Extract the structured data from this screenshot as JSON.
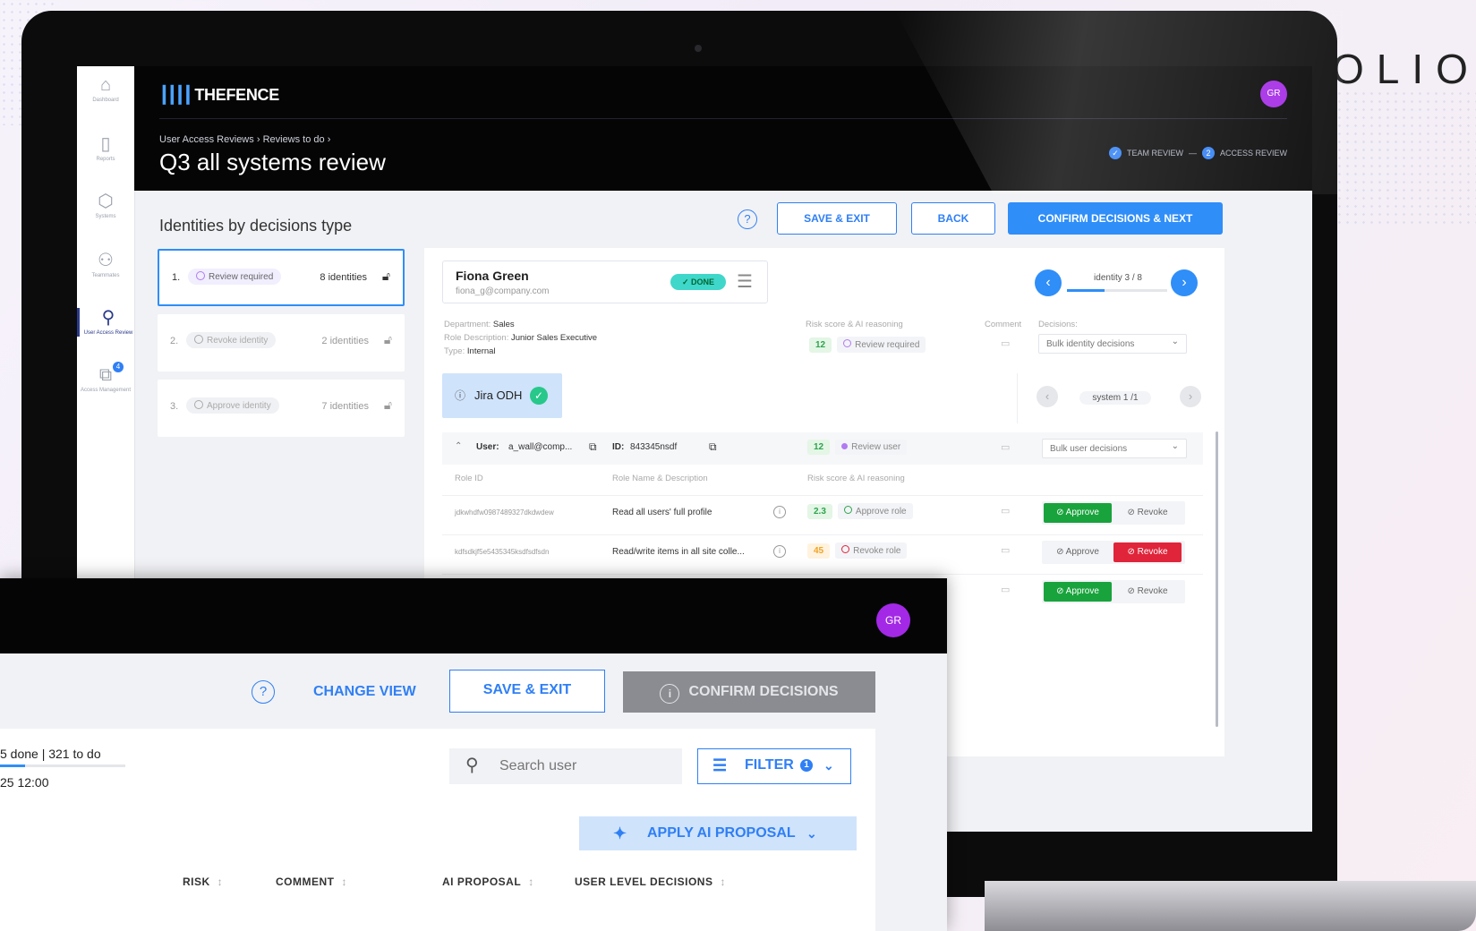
{
  "brand": "OLIO",
  "main": {
    "app_name": "THEFENCE",
    "avatar": "GR",
    "breadcrumb": [
      "User Access Reviews",
      "Reviews to do"
    ],
    "breadcrumb_sep": "›",
    "title": "Q3 all systems review",
    "steps": [
      {
        "label": "TEAM REVIEW",
        "state": "done"
      },
      {
        "label": "ACCESS REVIEW",
        "number": "2"
      }
    ],
    "sidebar": [
      {
        "label": "Dashboard",
        "icon": "home-icon"
      },
      {
        "label": "Reports",
        "icon": "document-icon"
      },
      {
        "label": "Systems",
        "icon": "database-icon"
      },
      {
        "label": "Teammates",
        "icon": "users-icon"
      },
      {
        "label": "User Access Review",
        "icon": "search-user-icon",
        "active": true
      },
      {
        "label": "Access Management",
        "icon": "package-icon",
        "badge": "4"
      }
    ],
    "section_title": "Identities by decisions type",
    "buttons": {
      "save_exit": "SAVE & EXIT",
      "back": "BACK",
      "confirm_next": "CONFIRM DECISIONS & NEXT"
    },
    "decision_types": [
      {
        "num": "1.",
        "label": "Review required",
        "count": "8 identities",
        "selected": true
      },
      {
        "num": "2.",
        "label": "Revoke identity",
        "count": "2 identities"
      },
      {
        "num": "3.",
        "label": "Approve identity",
        "count": "7 identities"
      }
    ],
    "identity": {
      "name": "Fiona Green",
      "email": "fiona_g@company.com",
      "status": "DONE",
      "pager": "identity 3 / 8",
      "pager_progress": 0.375,
      "department_label": "Department:",
      "department": "Sales",
      "role_label": "Role Description:",
      "role": "Junior Sales Executive",
      "type_label": "Type:",
      "type": "Internal",
      "risk_label": "Risk score & AI reasoning",
      "risk_score": "12",
      "risk_text": "Review required",
      "comment_label": "Comment",
      "decisions_label": "Decisions:",
      "bulk_select": "Bulk identity decisions"
    },
    "system": {
      "name": "Jira ODH",
      "pager": "system 1 /1"
    },
    "user_row": {
      "user_label": "User:",
      "user": "a_wall@comp...",
      "id_label": "ID:",
      "id": "843345nsdf",
      "score": "12",
      "status": "Review user",
      "bulk_select": "Bulk user decisions"
    },
    "role_columns": [
      "Role ID",
      "Role Name & Description",
      "Risk score & AI reasoning"
    ],
    "roles": [
      {
        "id": "jdkwhdfw0987489327dkdwdew",
        "name": "Read all users' full profile",
        "score": "2.3",
        "score_color": "green",
        "reason": "Approve role",
        "decision": "approve"
      },
      {
        "id": "kdfsdkjf5e5435345ksdfsdfsdn",
        "name": "Read/write items in all site colle...",
        "score": "45",
        "score_color": "orange",
        "reason": "Revoke role",
        "decision": "revoke"
      },
      {
        "id": "",
        "name": "",
        "score": "",
        "score_color": "green",
        "reason": "",
        "decision": "approve"
      }
    ],
    "approve_label": "Approve",
    "revoke_label": "Revoke"
  },
  "overlay": {
    "avatar": "GR",
    "change_view": "CHANGE VIEW",
    "save_exit": "SAVE & EXIT",
    "confirm": "CONFIRM DECISIONS",
    "progress_text": "5 done | 321 to do",
    "progress_fraction": 0.2,
    "date": "25 12:00",
    "search_placeholder": "Search user",
    "filter": "FILTER",
    "filter_count": "1",
    "apply_ai": "APPLY AI PROPOSAL",
    "columns": [
      "RISK",
      "COMMENT",
      "AI PROPOSAL",
      "USER LEVEL DECISIONS"
    ]
  },
  "colors": {
    "accent": "#2f8ef8",
    "avatar": "#a329e6",
    "approve": "#19a33d",
    "revoke": "#e0243a",
    "done": "#3fd7c9"
  }
}
